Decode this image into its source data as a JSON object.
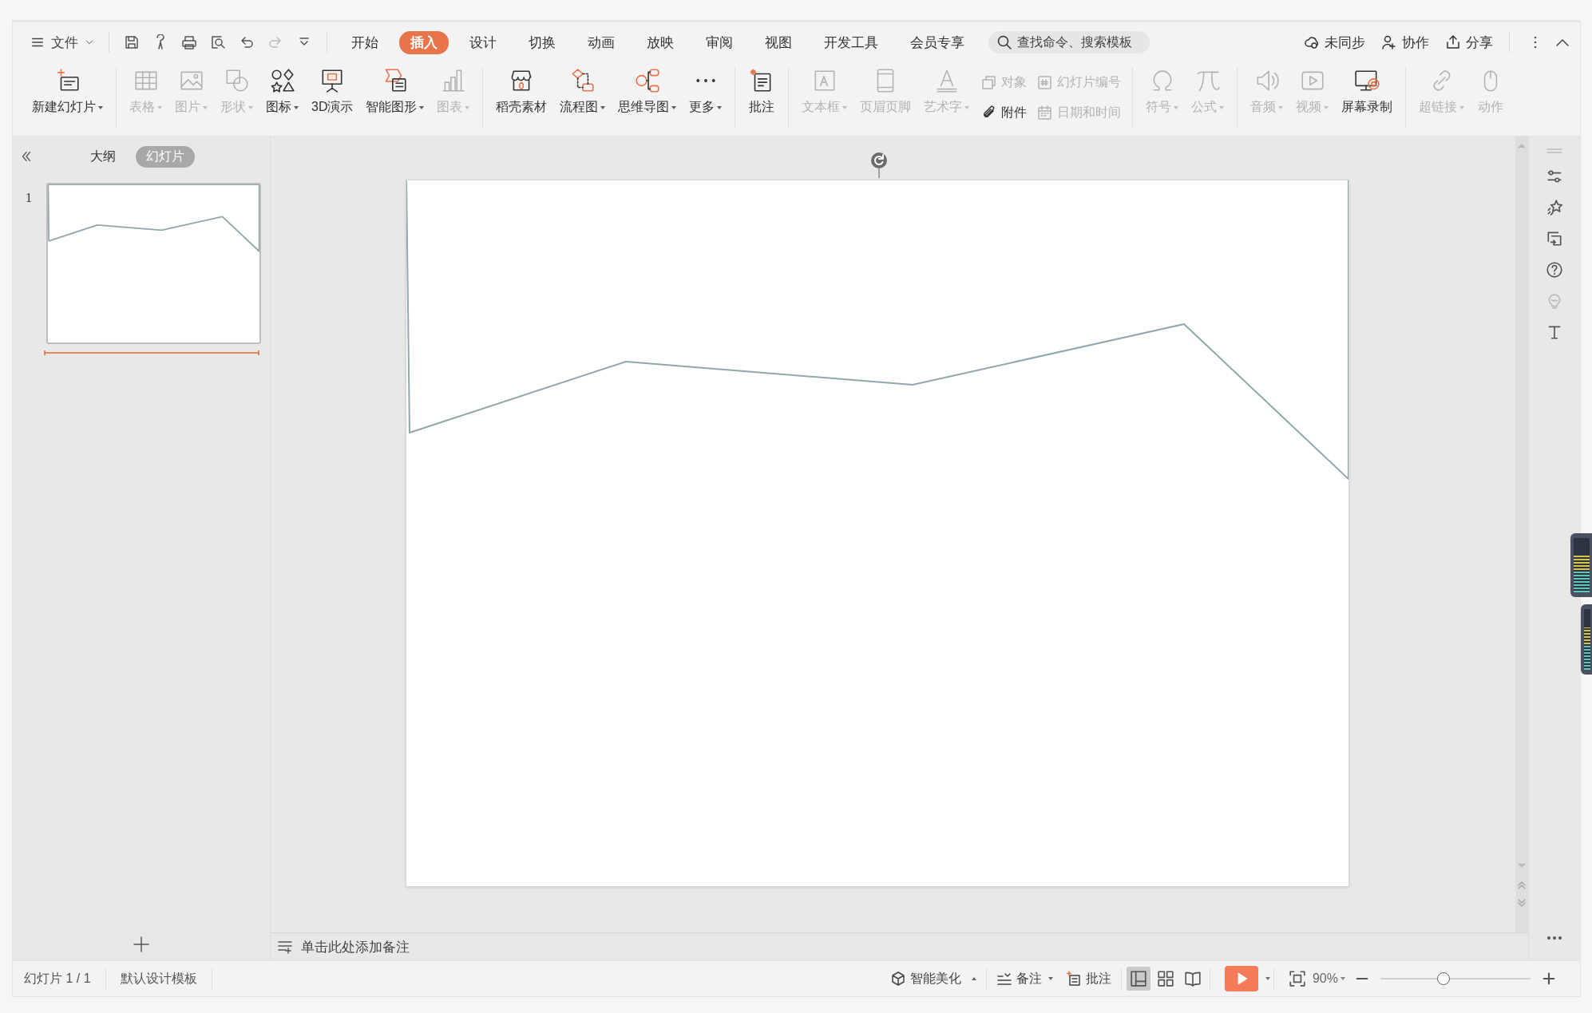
{
  "menu": {
    "file": "文件",
    "quick_access": [
      {
        "disabled": false
      },
      {
        "disabled": false
      },
      {
        "disabled": false
      },
      {
        "disabled": false
      },
      {
        "disabled": false
      },
      {
        "disabled": true
      },
      {
        "disabled": false
      }
    ],
    "tabs": [
      {
        "label": "开始",
        "selected": false
      },
      {
        "label": "插入",
        "selected": true
      },
      {
        "label": "设计",
        "selected": false
      },
      {
        "label": "切换",
        "selected": false
      },
      {
        "label": "动画",
        "selected": false
      },
      {
        "label": "放映",
        "selected": false
      },
      {
        "label": "审阅",
        "selected": false
      },
      {
        "label": "视图",
        "selected": false
      },
      {
        "label": "开发工具",
        "selected": false
      },
      {
        "label": "会员专享",
        "selected": false
      }
    ],
    "search": {
      "placeholder": "查找命令、搜索模板"
    },
    "actions": [
      {
        "label": "未同步"
      },
      {
        "label": "协作"
      },
      {
        "label": "分享"
      }
    ]
  },
  "ribbon": {
    "groups": [
      {
        "items": [
          {
            "kind": "large",
            "label": "新建幻灯片",
            "disabled": false,
            "dropdown": true
          }
        ]
      },
      {
        "items": [
          {
            "kind": "large",
            "label": "表格",
            "disabled": true,
            "dropdown": true
          },
          {
            "kind": "large",
            "label": "图片",
            "disabled": true,
            "dropdown": true
          },
          {
            "kind": "large",
            "label": "形状",
            "disabled": true,
            "dropdown": true
          },
          {
            "kind": "large",
            "label": "图标",
            "disabled": false,
            "dropdown": true
          },
          {
            "kind": "large",
            "label": "3D演示",
            "disabled": false,
            "dropdown": false
          },
          {
            "kind": "large",
            "label": "智能图形",
            "disabled": false,
            "dropdown": true
          },
          {
            "kind": "large",
            "label": "图表",
            "disabled": true,
            "dropdown": true
          }
        ]
      },
      {
        "items": [
          {
            "kind": "large",
            "label": "稻壳素材",
            "disabled": false,
            "dropdown": false
          },
          {
            "kind": "large",
            "label": "流程图",
            "disabled": false,
            "dropdown": true
          },
          {
            "kind": "large",
            "label": "思维导图",
            "disabled": false,
            "dropdown": true
          },
          {
            "kind": "large",
            "label": "更多",
            "disabled": false,
            "dropdown": true
          }
        ]
      },
      {
        "items": [
          {
            "kind": "large",
            "label": "批注",
            "disabled": false,
            "dropdown": false
          }
        ]
      },
      {
        "items": [
          {
            "kind": "large",
            "label": "文本框",
            "disabled": true,
            "dropdown": true
          },
          {
            "kind": "large",
            "label": "页眉页脚",
            "disabled": true,
            "dropdown": false
          },
          {
            "kind": "large",
            "label": "艺术字",
            "disabled": true,
            "dropdown": true
          },
          {
            "kind": "stack",
            "entries": [
              {
                "label": "对象",
                "disabled": true
              },
              {
                "label": "附件",
                "disabled": false
              }
            ]
          },
          {
            "kind": "stack",
            "entries": [
              {
                "label": "幻灯片编号",
                "disabled": true
              },
              {
                "label": "日期和时间",
                "disabled": true
              }
            ]
          }
        ]
      },
      {
        "items": [
          {
            "kind": "large",
            "label": "符号",
            "disabled": true,
            "dropdown": true
          },
          {
            "kind": "large",
            "label": "公式",
            "disabled": true,
            "dropdown": true
          }
        ]
      },
      {
        "items": [
          {
            "kind": "large",
            "label": "音频",
            "disabled": true,
            "dropdown": true
          },
          {
            "kind": "large",
            "label": "视频",
            "disabled": true,
            "dropdown": true
          },
          {
            "kind": "large",
            "label": "屏幕录制",
            "disabled": false,
            "dropdown": false
          }
        ]
      },
      {
        "items": [
          {
            "kind": "large",
            "label": "超链接",
            "disabled": true,
            "dropdown": true
          },
          {
            "kind": "large",
            "label": "动作",
            "disabled": true,
            "dropdown": false
          }
        ]
      }
    ]
  },
  "slides_panel": {
    "tabs": [
      {
        "label": "大纲",
        "selected": false
      },
      {
        "label": "幻灯片",
        "selected": true
      }
    ],
    "slides": [
      {
        "number": "1",
        "selected": true
      }
    ]
  },
  "side_tools": [
    {
      "disabled": false
    },
    {
      "disabled": false
    },
    {
      "disabled": false
    },
    {
      "disabled": false
    },
    {
      "disabled": true
    },
    {
      "disabled": false
    }
  ],
  "notes": {
    "placeholder": "单击此处添加备注"
  },
  "status_bar": {
    "slide_info": "幻灯片 1 / 1",
    "template": "默认设计模板",
    "beautify": "智能美化",
    "notes": "备注",
    "comments": "批注",
    "views": [
      {
        "selected": true
      },
      {
        "selected": false
      },
      {
        "selected": false
      }
    ],
    "zoom": "90%",
    "zoom_slider": {
      "level": 0.42
    }
  }
}
